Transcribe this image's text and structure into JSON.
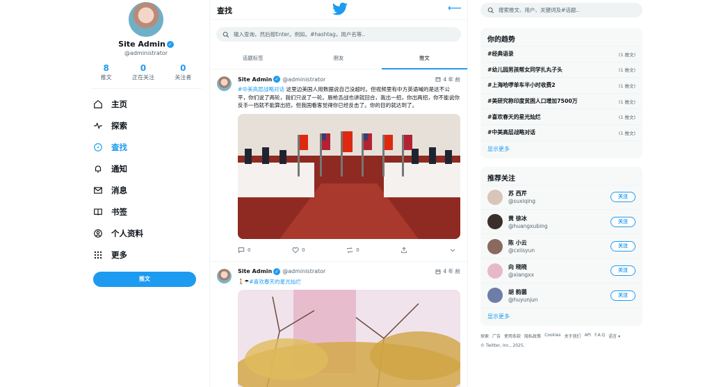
{
  "colors": {
    "accent": "#1d9bf0",
    "text": "#0f1419",
    "muted": "#536471",
    "border": "#eff3f4"
  },
  "profile": {
    "name": "Site Admin",
    "handle": "@administrator",
    "stats": [
      {
        "value": "8",
        "label": "推文"
      },
      {
        "value": "0",
        "label": "正在关注"
      },
      {
        "value": "0",
        "label": "关注者"
      }
    ]
  },
  "nav": [
    {
      "label": "主页",
      "icon": "home-icon"
    },
    {
      "label": "探索",
      "icon": "pulse-icon"
    },
    {
      "label": "查找",
      "icon": "compass-icon"
    },
    {
      "label": "通知",
      "icon": "bell-icon"
    },
    {
      "label": "消息",
      "icon": "mail-icon"
    },
    {
      "label": "书签",
      "icon": "book-icon"
    },
    {
      "label": "个人资料",
      "icon": "user-icon"
    },
    {
      "label": "更多",
      "icon": "grid-icon"
    }
  ],
  "tweet_button": "推文",
  "main": {
    "title": "查找",
    "search_placeholder": "输入查询，然后按Enter。例如。#hashtag，用户名等..",
    "tabs": [
      "话题标签",
      "朋友",
      "推文"
    ],
    "tweets": [
      {
        "name": "Site Admin",
        "handle": "@administrator",
        "time": "4 年 前",
        "tag": "#中美高层战略对话",
        "text": " 这里边美国人用数据说自己没超时。但视频里有中方英语喊的是这不公平，你们说了两轮，我们只说了一轮。唇枪舌战也讲就回合，我出一招，你出两招，你不能说你反手一挡就不能算出招，但我国看客觉得你已经反击了。你的目的就达到了。",
        "comments": "0",
        "likes": "0",
        "reposts": "0"
      },
      {
        "name": "Site Admin",
        "handle": "@administrator",
        "time": "4 年 前",
        "prefix": "🚶☂",
        "tag": "#喜欢春天的星光灿烂",
        "text": ""
      }
    ]
  },
  "right": {
    "search_placeholder": "搜索推文、用户、关键词及#话题..",
    "trends_title": "你的趋势",
    "trends": [
      {
        "tag": "#经典语录",
        "count": "(1 推文)"
      },
      {
        "tag": "#幼儿园男孩帮女同学扎丸子头",
        "count": "(1 推文)"
      },
      {
        "tag": "#上海哈啰单车半小时收费2",
        "count": "(1 推文)"
      },
      {
        "tag": "#美研究称印度贫困人口增加7500万",
        "count": "(1 推文)"
      },
      {
        "tag": "#喜欢春天的星光灿烂",
        "count": "(1 推文)"
      },
      {
        "tag": "#中美高层战略对话",
        "count": "(1 推文)"
      }
    ],
    "show_more": "显示更多",
    "follow_title": "推荐关注",
    "follows": [
      {
        "name": "苏 西芹",
        "handle": "@suxiqing",
        "color": "#d9c4b8"
      },
      {
        "name": "黄 徐冰",
        "handle": "@huangxubing",
        "color": "#3b2f2c"
      },
      {
        "name": "陈 小云",
        "handle": "@cxiisyun",
        "color": "#8a6a5e"
      },
      {
        "name": "向 晓晓",
        "handle": "@xiangxx",
        "color": "#e7b9c8"
      },
      {
        "name": "胡 韵菌",
        "handle": "@huyunjun",
        "color": "#6c7ea8"
      }
    ],
    "follow_button": "关注",
    "show_more_follow": "显示更多",
    "footer_links": [
      "探索",
      "广告",
      "使用条款",
      "隐私政策",
      "Cookies",
      "关于我们",
      "API",
      "F.A.Q",
      "语言 ▾"
    ],
    "copyright": "© Twitter, Inc., 2025."
  }
}
